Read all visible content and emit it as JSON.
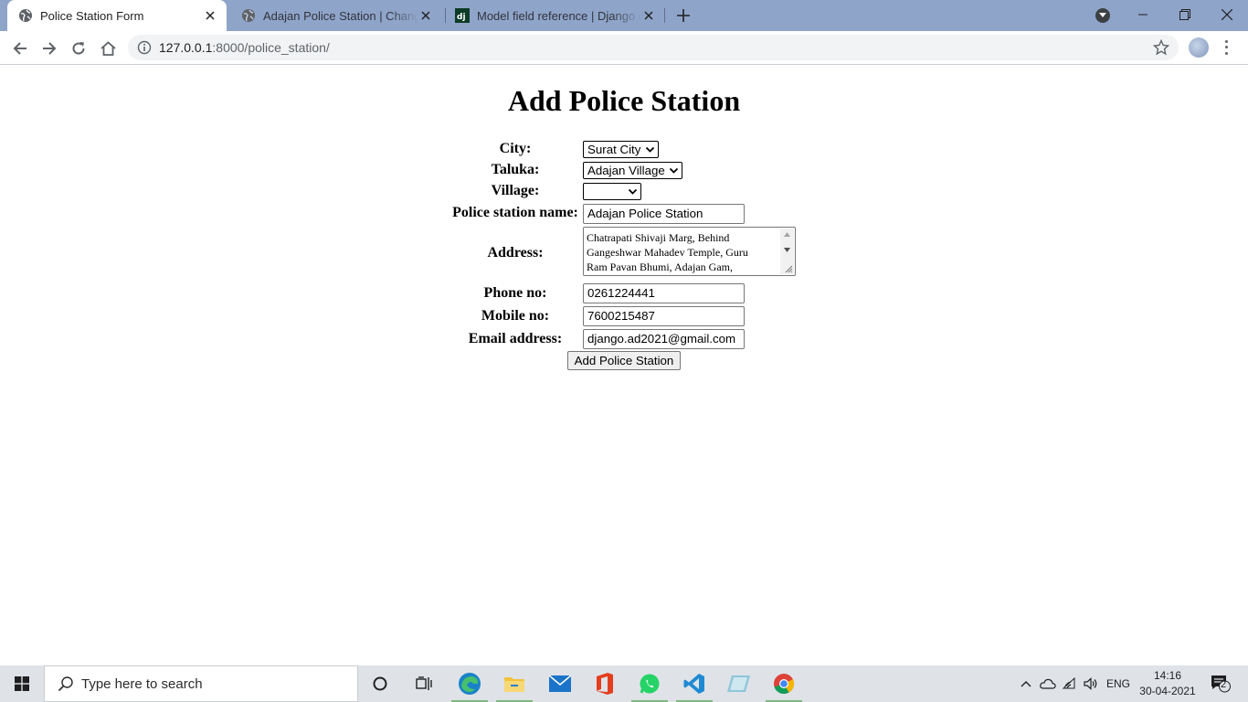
{
  "browser": {
    "tabs": [
      {
        "title": "Police Station Form",
        "active": true
      },
      {
        "title": "Adajan Police Station | Change police station",
        "active": false
      },
      {
        "title": "Model field reference | Django documentation",
        "active": false
      }
    ],
    "address_bar": {
      "host": "127.0.0.1",
      "port_path": ":8000/police_station/"
    }
  },
  "page": {
    "heading": "Add Police Station",
    "form": {
      "city": {
        "label": "City:",
        "value": "Surat City"
      },
      "taluka": {
        "label": "Taluka:",
        "value": "Adajan Village"
      },
      "village": {
        "label": "Village:",
        "value": ""
      },
      "station_name": {
        "label": "Police station name:",
        "value": "Adajan Police Station"
      },
      "address": {
        "label": "Address:",
        "value": "Chatrapati Shivaji Marg, Behind\nGangeshwar Mahadev Temple, Guru\nRam Pavan Bhumi, Adajan Gam,"
      },
      "phone": {
        "label": "Phone no:",
        "value": "0261224441"
      },
      "mobile": {
        "label": "Mobile no:",
        "value": "7600215487"
      },
      "email": {
        "label": "Email address:",
        "value": "django.ad2021@gmail.com"
      },
      "submit_label": "Add Police Station"
    }
  },
  "taskbar": {
    "search_placeholder": "Type here to search",
    "language": "ENG",
    "time": "14:16",
    "date": "30-04-2021",
    "notification_count": "2",
    "icons": [
      "cortana-icon",
      "task-view-icon",
      "edge-icon",
      "file-explorer-icon",
      "mail-icon",
      "office-icon",
      "whatsapp-icon",
      "vscode-icon",
      "app-icon",
      "chrome-icon"
    ]
  },
  "colors": {
    "tabstrip": "#8fa4c9",
    "taskbar": "#dfe3e8",
    "running_indicator": "#7fb77e"
  }
}
